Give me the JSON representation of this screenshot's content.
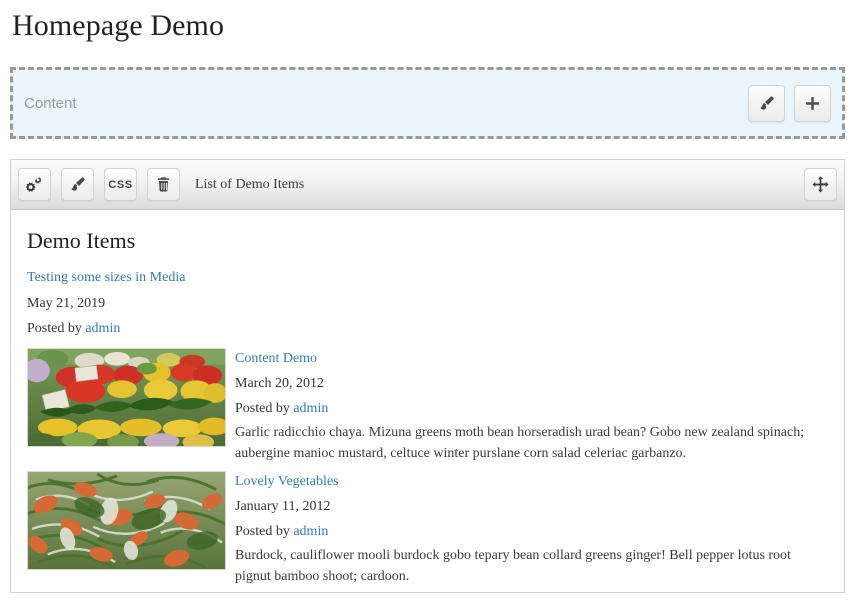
{
  "page": {
    "title": "Homepage Demo"
  },
  "dropzone": {
    "label": "Content",
    "buttons": [
      {
        "name": "paint-button",
        "icon": "paintbrush-icon",
        "label": ""
      },
      {
        "name": "add-button",
        "icon": "plus-icon",
        "label": ""
      }
    ]
  },
  "panel": {
    "title": "List of Demo Items",
    "tools": [
      {
        "name": "settings-button",
        "icon": "cogs-icon",
        "label": ""
      },
      {
        "name": "style-button",
        "icon": "paintbrush-icon",
        "label": ""
      },
      {
        "name": "css-button",
        "icon": "css-text-icon",
        "label": "css"
      },
      {
        "name": "delete-button",
        "icon": "trash-icon",
        "label": ""
      }
    ],
    "move_handle": {
      "name": "move-handle",
      "icon": "move-arrows-icon"
    }
  },
  "list": {
    "heading": "Demo Items",
    "posted_by_prefix": "Posted by",
    "items": [
      {
        "title": "Testing some sizes in Media",
        "date": "May 21, 2019",
        "author": "admin",
        "body": "",
        "thumb": "none"
      },
      {
        "title": "Content Demo",
        "date": "March 20, 2012",
        "author": "admin",
        "body": "Garlic radicchio chaya. Mizuna greens moth bean horseradish urad bean? Gobo new zealand spinach; aubergine manioc mustard, celtuce winter purslane corn salad celeriac garbanzo.",
        "thumb": "vegetable-market-photo"
      },
      {
        "title": "Lovely Vegetables",
        "date": "January 11, 2012",
        "author": "admin",
        "body": "Burdock, cauliflower mooli burdock gobo tepary bean collard greens ginger! Bell pepper lotus root pignut bamboo shoot; cardoon.",
        "thumb": "salad-greens-photo"
      }
    ]
  },
  "colors": {
    "link": "#337ab7",
    "dropzone_bg": "#e9f5fb",
    "dropzone_border": "#999999",
    "panel_border": "#cfcfcf"
  }
}
